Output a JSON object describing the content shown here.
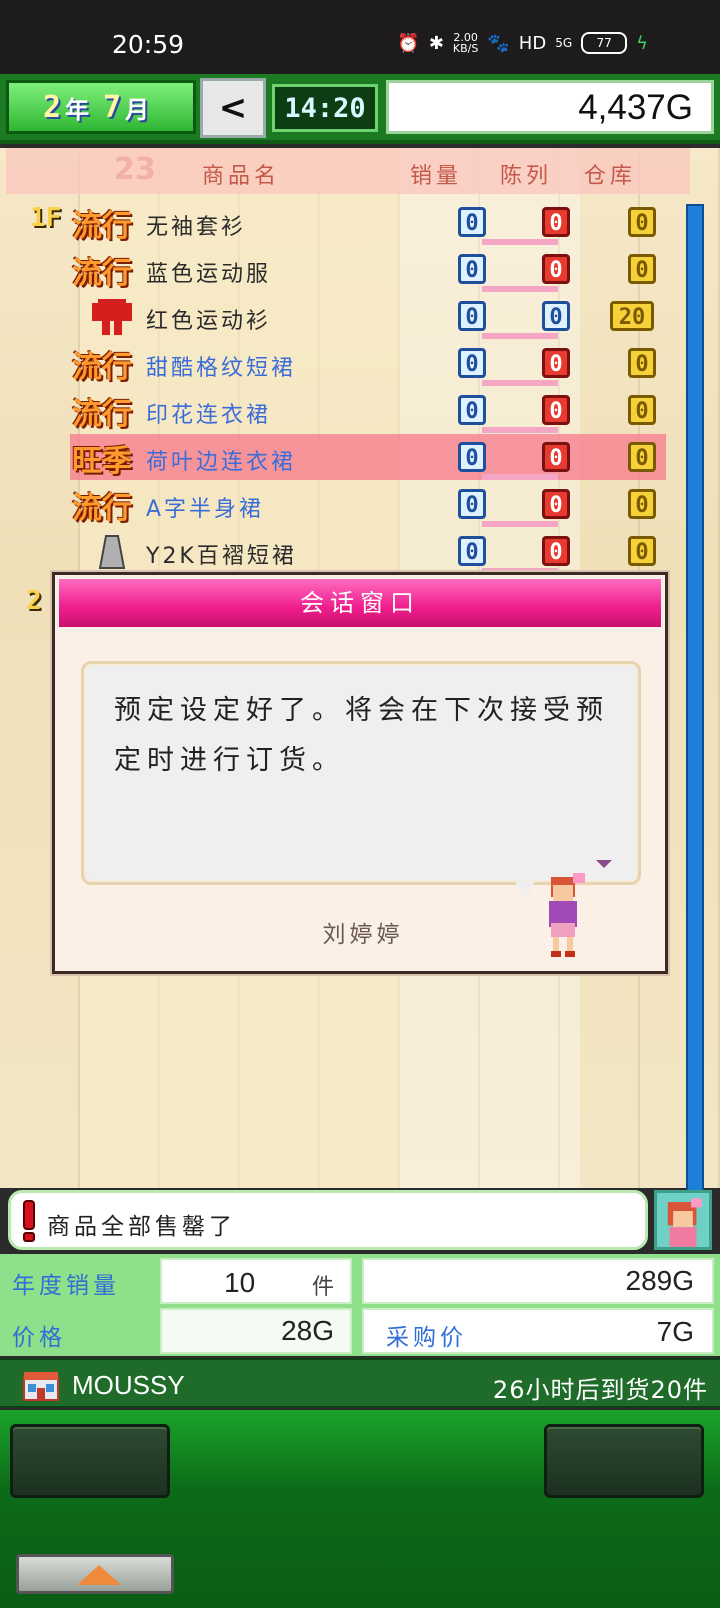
{
  "status_bar": {
    "time": "20:59",
    "net_speed": "2.00",
    "net_unit": "KB/S",
    "signal": "5G",
    "battery": "77"
  },
  "hud": {
    "year_num": "2",
    "year_unit": "年",
    "month_num": "7",
    "month_unit": "月",
    "clock_arrow": "<",
    "game_time": "14:20",
    "money": "4,437G"
  },
  "table": {
    "badge": "23",
    "headers": {
      "name": "商品名",
      "sold": "销量",
      "display": "陈列",
      "stock": "仓库"
    },
    "floors": [
      "1F",
      "2"
    ],
    "rows": [
      {
        "tag": "流行",
        "name": "无袖套衫",
        "sold": "0",
        "display": "0",
        "stock": "0",
        "color": "dark"
      },
      {
        "tag": "流行",
        "name": "蓝色运动服",
        "sold": "0",
        "display": "0",
        "stock": "0",
        "color": "dark"
      },
      {
        "tag": "",
        "name": "红色运动衫",
        "sold": "0",
        "display": "0",
        "stock": "20",
        "color": "dark"
      },
      {
        "tag": "流行",
        "name": "甜酷格纹短裙",
        "sold": "0",
        "display": "0",
        "stock": "0",
        "color": "blue"
      },
      {
        "tag": "流行",
        "name": "印花连衣裙",
        "sold": "0",
        "display": "0",
        "stock": "0",
        "color": "blue"
      },
      {
        "tag": "旺季",
        "name": "荷叶边连衣裙",
        "sold": "0",
        "display": "0",
        "stock": "0",
        "color": "blue"
      },
      {
        "tag": "流行",
        "name": "A字半身裙",
        "sold": "0",
        "display": "0",
        "stock": "0",
        "color": "blue"
      },
      {
        "tag": "",
        "name": "Y2K百褶短裙",
        "sold": "0",
        "display": "0",
        "stock": "0",
        "color": "dark"
      }
    ]
  },
  "dialog": {
    "title": "会话窗口",
    "message": "预定设定好了。将会在下次接受预定时进行订货。",
    "speaker": "刘婷婷"
  },
  "ticker": {
    "text": "商品全部售罄了"
  },
  "stats": {
    "annual_sales_label": "年度销量",
    "annual_sales_count": "10",
    "annual_sales_unit": "件",
    "annual_sales_amount": "289G",
    "price_label": "价格",
    "price": "28G",
    "purchase_label": "采购价",
    "purchase_price": "7G"
  },
  "supplier": {
    "brand": "MOUSSY",
    "arrival": "26小时后到货20件"
  },
  "colors": {
    "accent_green": "#1c7a22",
    "dialog_title": "#ef1d8c",
    "highlight_row": "#f7788c",
    "scrollbar": "#1e7fd9"
  }
}
